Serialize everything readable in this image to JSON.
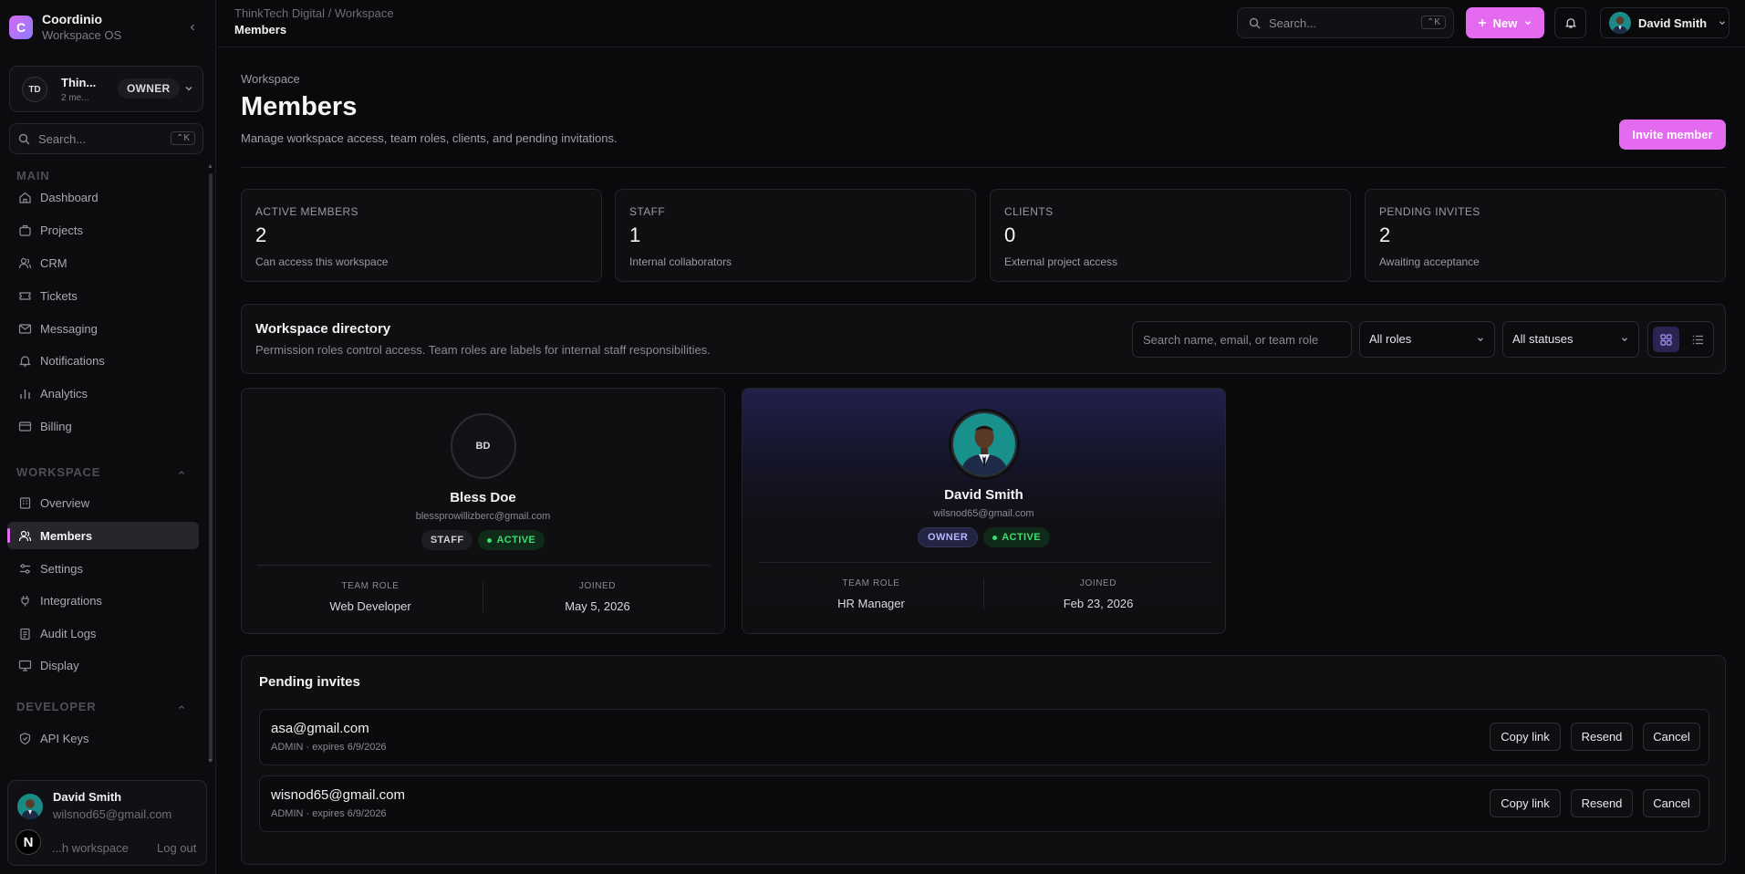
{
  "app": {
    "name": "Coordinio",
    "subtitle": "Workspace OS",
    "logo_letter": "C"
  },
  "workspace_switcher": {
    "initials": "TD",
    "name": "Thin...",
    "count": "2 me...",
    "role": "OWNER"
  },
  "sidebar_search": {
    "placeholder": "Search...",
    "shortcut": "⌃K"
  },
  "sidebar": {
    "main_title": "MAIN",
    "main_items": [
      {
        "label": "Dashboard",
        "icon": "home-icon"
      },
      {
        "label": "Projects",
        "icon": "briefcase-icon"
      },
      {
        "label": "CRM",
        "icon": "users-icon"
      },
      {
        "label": "Tickets",
        "icon": "ticket-icon"
      },
      {
        "label": "Messaging",
        "icon": "mail-icon"
      },
      {
        "label": "Notifications",
        "icon": "bell-icon"
      },
      {
        "label": "Analytics",
        "icon": "bar-chart-icon"
      },
      {
        "label": "Billing",
        "icon": "credit-card-icon"
      }
    ],
    "workspace_title": "WORKSPACE",
    "workspace_items": [
      {
        "label": "Overview",
        "icon": "building-icon"
      },
      {
        "label": "Members",
        "icon": "users-icon",
        "active": true
      },
      {
        "label": "Settings",
        "icon": "sliders-icon"
      },
      {
        "label": "Integrations",
        "icon": "plug-icon"
      },
      {
        "label": "Audit Logs",
        "icon": "clipboard-icon"
      },
      {
        "label": "Display",
        "icon": "monitor-icon"
      }
    ],
    "developer_title": "DEVELOPER",
    "developer_items": [
      {
        "label": "API Keys",
        "icon": "shield-icon"
      }
    ]
  },
  "sidebar_user": {
    "name": "David Smith",
    "email": "wilsnod65@gmail.com",
    "switch_label": "...h workspace",
    "logout_label": "Log out",
    "badge_letter": "N"
  },
  "topbar": {
    "breadcrumb": "ThinkTech Digital / Workspace",
    "title": "Members",
    "search_placeholder": "Search...",
    "search_shortcut": "⌃K",
    "new_label": "New",
    "user_name": "David Smith"
  },
  "page": {
    "eyebrow": "Workspace",
    "title": "Members",
    "subtitle": "Manage workspace access, team roles, clients, and pending invitations.",
    "invite_label": "Invite member"
  },
  "stats": [
    {
      "label": "ACTIVE MEMBERS",
      "value": "2",
      "sub": "Can access this workspace"
    },
    {
      "label": "STAFF",
      "value": "1",
      "sub": "Internal collaborators"
    },
    {
      "label": "CLIENTS",
      "value": "0",
      "sub": "External project access"
    },
    {
      "label": "PENDING INVITES",
      "value": "2",
      "sub": "Awaiting acceptance"
    }
  ],
  "directory": {
    "title": "Workspace directory",
    "subtitle": "Permission roles control access. Team roles are labels for internal staff responsibilities.",
    "search_placeholder": "Search name, email, or team role",
    "role_filter": "All roles",
    "status_filter": "All statuses"
  },
  "members": [
    {
      "initials": "BD",
      "name": "Bless Doe",
      "email": "blessprowillizberc@gmail.com",
      "role_badge": "STAFF",
      "status": "ACTIVE",
      "team_role_label": "TEAM ROLE",
      "team_role": "Web Developer",
      "joined_label": "JOINED",
      "joined": "May 5, 2026"
    },
    {
      "initials": "",
      "name": "David Smith",
      "email": "wilsnod65@gmail.com",
      "role_badge": "OWNER",
      "status": "ACTIVE",
      "team_role_label": "TEAM ROLE",
      "team_role": "HR Manager",
      "joined_label": "JOINED",
      "joined": "Feb 23, 2026"
    }
  ],
  "pending": {
    "title": "Pending invites",
    "invites": [
      {
        "email": "asa@gmail.com",
        "meta": "ADMIN · expires 6/9/2026"
      },
      {
        "email": "wisnod65@gmail.com",
        "meta": "ADMIN · expires 6/9/2026"
      }
    ],
    "copy_label": "Copy link",
    "resend_label": "Resend",
    "cancel_label": "Cancel"
  },
  "colors": {
    "accent": "#e46af0",
    "active_green": "#3ddc72",
    "owner_badge": "#b7b5ff"
  }
}
